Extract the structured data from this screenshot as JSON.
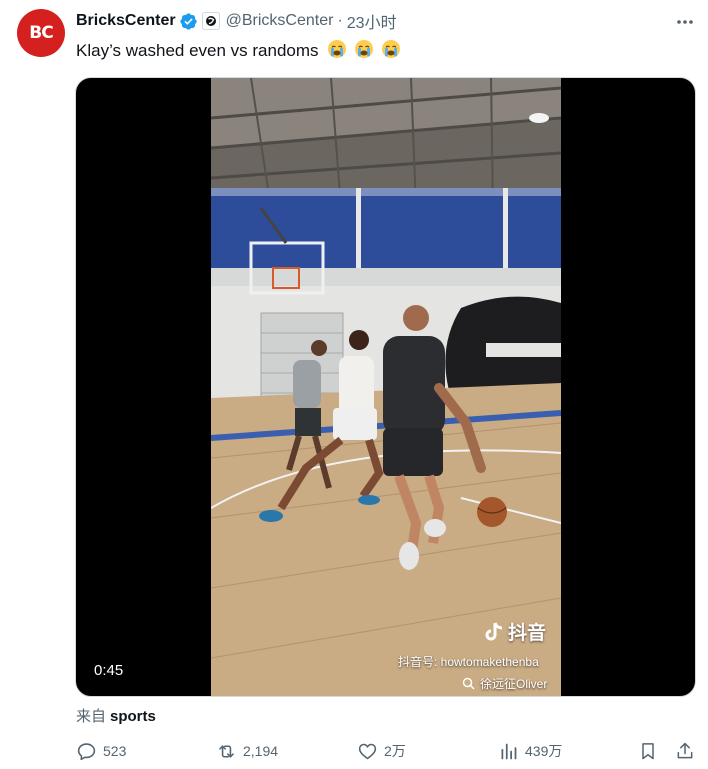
{
  "tweet": {
    "author_name": "BricksCenter",
    "handle": "@BricksCenter",
    "separator": "·",
    "time": "23小时",
    "text": "Klay’s washed even vs randoms",
    "emoji": [
      "crying-face",
      "crying-face",
      "crying-face"
    ],
    "avatar_text": "BC"
  },
  "video": {
    "duration": "0:45",
    "watermark_app": "抖音",
    "watermark_id": "抖音号: howtomakethenba",
    "watermark_search": "徐远征Oliver"
  },
  "source": {
    "prefix": "来自",
    "label": "sports"
  },
  "actions": {
    "replies": "523",
    "retweets": "2,194",
    "likes": "2万",
    "views": "439万"
  },
  "colors": {
    "avatar": "#d4201f",
    "verified": "#1d9bf0",
    "muted_text": "#536471",
    "primary_text": "#0f1419"
  }
}
